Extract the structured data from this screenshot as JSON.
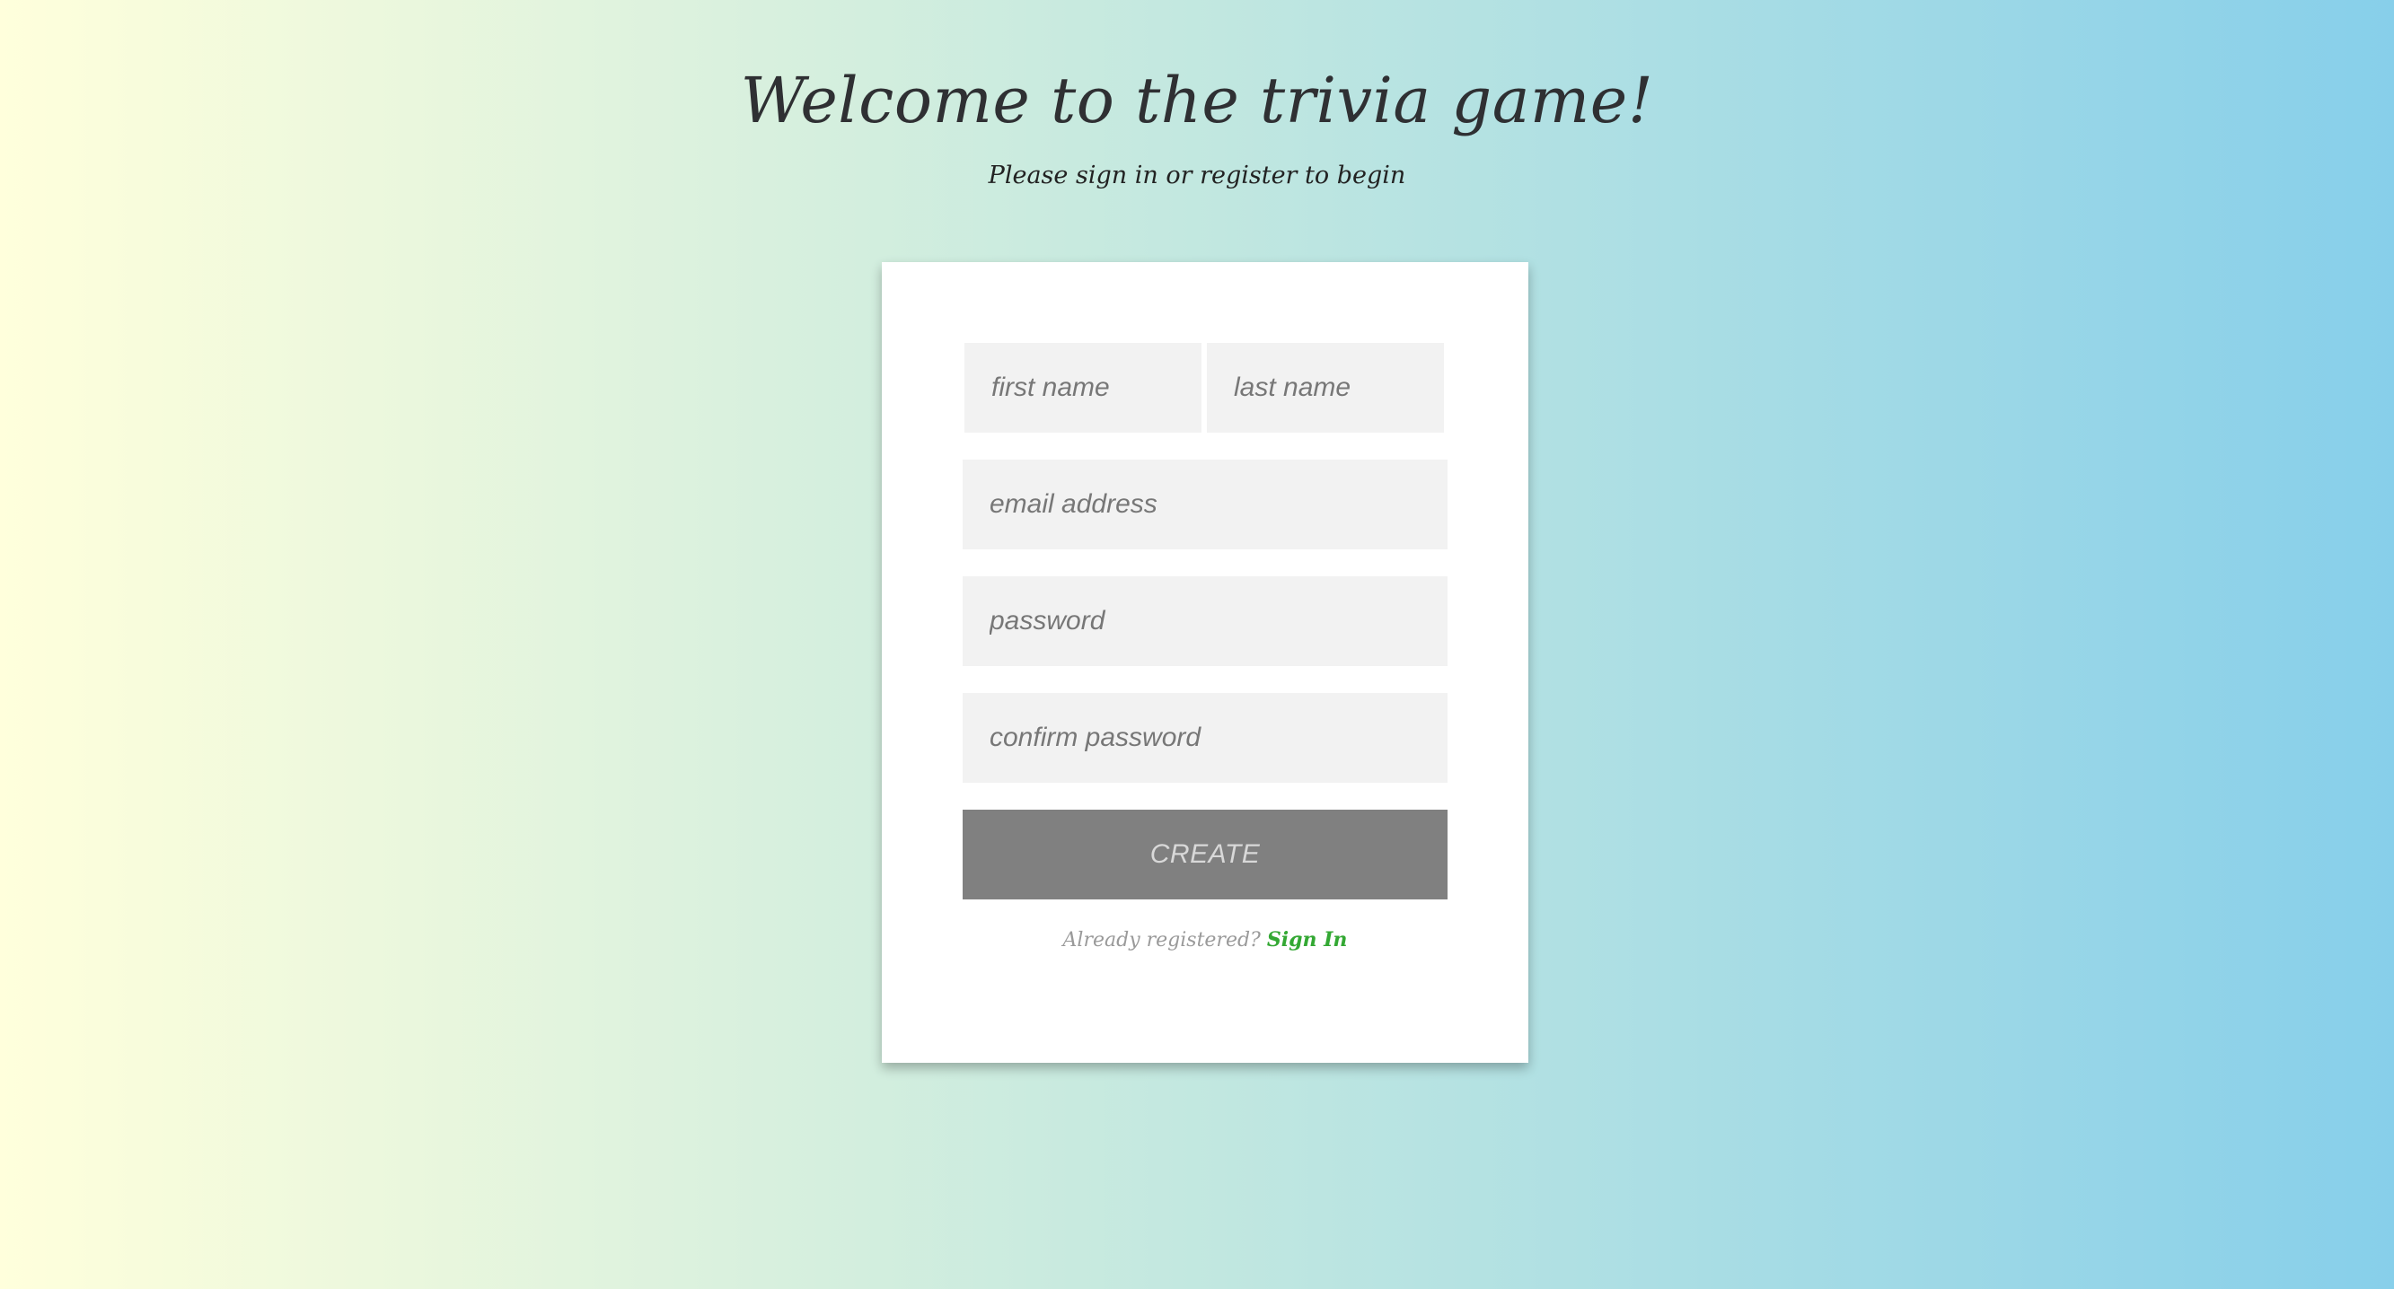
{
  "header": {
    "title": "Welcome to the trivia game!",
    "subtitle": "Please sign in or register to begin"
  },
  "form": {
    "first_name_placeholder": "first name",
    "last_name_placeholder": "last name",
    "email_placeholder": "email address",
    "password_placeholder": "password",
    "confirm_password_placeholder": "confirm password",
    "create_label": "CREATE",
    "signin_prompt": "Already registered?",
    "signin_link": "Sign In"
  },
  "colors": {
    "background_start": "#ffffdc",
    "background_end": "#87cfea",
    "button": "#808080",
    "link": "#33a833",
    "field": "#f2f2f2"
  }
}
